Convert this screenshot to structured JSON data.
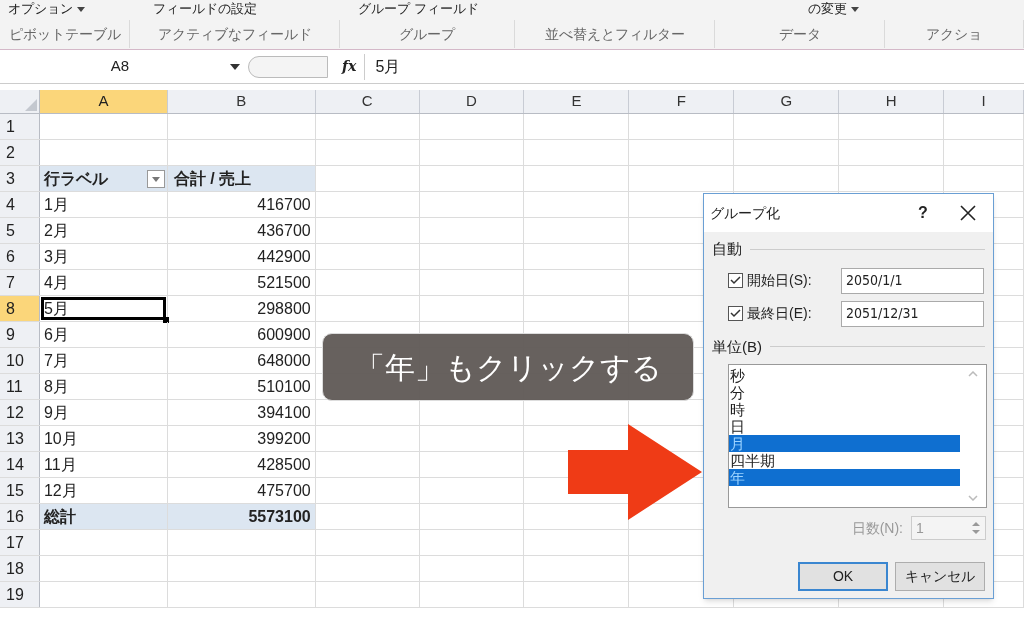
{
  "ribbon": {
    "buttons": [
      {
        "label": "オプション",
        "has_menu": true
      },
      {
        "label": "フィールドの設定",
        "has_menu": false
      },
      {
        "label": "グループ フィールド",
        "has_menu": false
      },
      {
        "label": "の変更",
        "has_menu": true
      }
    ],
    "groups": [
      "ピボットテーブル",
      "アクティブなフィールド",
      "グループ",
      "並べ替えとフィルター",
      "データ",
      "アクショ"
    ]
  },
  "formula_bar": {
    "name_box": "A8",
    "fx": "fx",
    "formula": "5月"
  },
  "columns": [
    {
      "label": "A",
      "selected": true
    },
    {
      "label": "B",
      "selected": false
    },
    {
      "label": "C",
      "selected": false
    },
    {
      "label": "D",
      "selected": false
    },
    {
      "label": "E",
      "selected": false
    },
    {
      "label": "F",
      "selected": false
    },
    {
      "label": "G",
      "selected": false
    },
    {
      "label": "H",
      "selected": false
    },
    {
      "label": "I",
      "selected": false
    }
  ],
  "rows": [
    {
      "number": "1",
      "selected": false
    },
    {
      "number": "2",
      "selected": false
    },
    {
      "number": "3",
      "kind": "header",
      "label": "行ラベル",
      "value": "合計 / 売上",
      "selected": false
    },
    {
      "number": "4",
      "kind": "item",
      "label": "1月",
      "value": "416700",
      "selected": false
    },
    {
      "number": "5",
      "kind": "item",
      "label": "2月",
      "value": "436700",
      "selected": false
    },
    {
      "number": "6",
      "kind": "item",
      "label": "3月",
      "value": "442900",
      "selected": false
    },
    {
      "number": "7",
      "kind": "item",
      "label": "4月",
      "value": "521500",
      "selected": false
    },
    {
      "number": "8",
      "kind": "item",
      "label": "5月",
      "value": "298800",
      "selected": true
    },
    {
      "number": "9",
      "kind": "item",
      "label": "6月",
      "value": "600900",
      "selected": false
    },
    {
      "number": "10",
      "kind": "item",
      "label": "7月",
      "value": "648000",
      "selected": false
    },
    {
      "number": "11",
      "kind": "item",
      "label": "8月",
      "value": "510100",
      "selected": false
    },
    {
      "number": "12",
      "kind": "item",
      "label": "9月",
      "value": "394100",
      "selected": false
    },
    {
      "number": "13",
      "kind": "item",
      "label": "10月",
      "value": "399200",
      "selected": false
    },
    {
      "number": "14",
      "kind": "item",
      "label": "11月",
      "value": "428500",
      "selected": false
    },
    {
      "number": "15",
      "kind": "item",
      "label": "12月",
      "value": "475700",
      "selected": false
    },
    {
      "number": "16",
      "kind": "total",
      "label": "総計",
      "value": "5573100",
      "selected": false
    },
    {
      "number": "17",
      "selected": false
    },
    {
      "number": "18",
      "selected": false
    },
    {
      "number": "19",
      "selected": false
    }
  ],
  "callout": "「年」もクリックする",
  "dialog": {
    "title": "グループ化",
    "help": "?",
    "auto_label": "自動",
    "start": {
      "label": "開始日(S):",
      "checked": true,
      "value": "2050/1/1"
    },
    "end": {
      "label": "最終日(E):",
      "checked": true,
      "value": "2051/12/31"
    },
    "unit_label": "単位(B)",
    "units": [
      {
        "label": "秒",
        "selected": false
      },
      {
        "label": "分",
        "selected": false
      },
      {
        "label": "時",
        "selected": false
      },
      {
        "label": "日",
        "selected": false
      },
      {
        "label": "月",
        "selected": true
      },
      {
        "label": "四半期",
        "selected": false
      },
      {
        "label": "年",
        "selected": true
      }
    ],
    "days": {
      "label": "日数(N):",
      "value": "1",
      "disabled": true
    },
    "ok": "OK",
    "cancel": "キャンセル"
  }
}
